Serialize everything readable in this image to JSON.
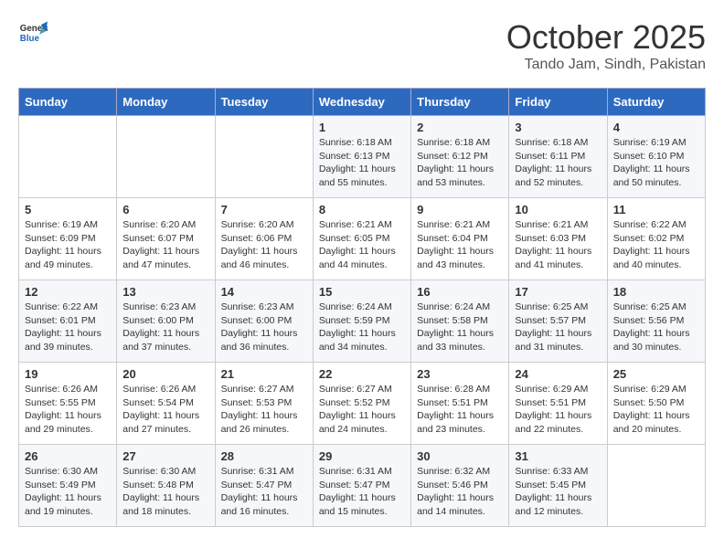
{
  "header": {
    "logo_line1": "General",
    "logo_line2": "Blue",
    "month": "October 2025",
    "location": "Tando Jam, Sindh, Pakistan"
  },
  "weekdays": [
    "Sunday",
    "Monday",
    "Tuesday",
    "Wednesday",
    "Thursday",
    "Friday",
    "Saturday"
  ],
  "weeks": [
    [
      {
        "day": "",
        "sunrise": "",
        "sunset": "",
        "daylight": ""
      },
      {
        "day": "",
        "sunrise": "",
        "sunset": "",
        "daylight": ""
      },
      {
        "day": "",
        "sunrise": "",
        "sunset": "",
        "daylight": ""
      },
      {
        "day": "1",
        "sunrise": "Sunrise: 6:18 AM",
        "sunset": "Sunset: 6:13 PM",
        "daylight": "Daylight: 11 hours and 55 minutes."
      },
      {
        "day": "2",
        "sunrise": "Sunrise: 6:18 AM",
        "sunset": "Sunset: 6:12 PM",
        "daylight": "Daylight: 11 hours and 53 minutes."
      },
      {
        "day": "3",
        "sunrise": "Sunrise: 6:18 AM",
        "sunset": "Sunset: 6:11 PM",
        "daylight": "Daylight: 11 hours and 52 minutes."
      },
      {
        "day": "4",
        "sunrise": "Sunrise: 6:19 AM",
        "sunset": "Sunset: 6:10 PM",
        "daylight": "Daylight: 11 hours and 50 minutes."
      }
    ],
    [
      {
        "day": "5",
        "sunrise": "Sunrise: 6:19 AM",
        "sunset": "Sunset: 6:09 PM",
        "daylight": "Daylight: 11 hours and 49 minutes."
      },
      {
        "day": "6",
        "sunrise": "Sunrise: 6:20 AM",
        "sunset": "Sunset: 6:07 PM",
        "daylight": "Daylight: 11 hours and 47 minutes."
      },
      {
        "day": "7",
        "sunrise": "Sunrise: 6:20 AM",
        "sunset": "Sunset: 6:06 PM",
        "daylight": "Daylight: 11 hours and 46 minutes."
      },
      {
        "day": "8",
        "sunrise": "Sunrise: 6:21 AM",
        "sunset": "Sunset: 6:05 PM",
        "daylight": "Daylight: 11 hours and 44 minutes."
      },
      {
        "day": "9",
        "sunrise": "Sunrise: 6:21 AM",
        "sunset": "Sunset: 6:04 PM",
        "daylight": "Daylight: 11 hours and 43 minutes."
      },
      {
        "day": "10",
        "sunrise": "Sunrise: 6:21 AM",
        "sunset": "Sunset: 6:03 PM",
        "daylight": "Daylight: 11 hours and 41 minutes."
      },
      {
        "day": "11",
        "sunrise": "Sunrise: 6:22 AM",
        "sunset": "Sunset: 6:02 PM",
        "daylight": "Daylight: 11 hours and 40 minutes."
      }
    ],
    [
      {
        "day": "12",
        "sunrise": "Sunrise: 6:22 AM",
        "sunset": "Sunset: 6:01 PM",
        "daylight": "Daylight: 11 hours and 39 minutes."
      },
      {
        "day": "13",
        "sunrise": "Sunrise: 6:23 AM",
        "sunset": "Sunset: 6:00 PM",
        "daylight": "Daylight: 11 hours and 37 minutes."
      },
      {
        "day": "14",
        "sunrise": "Sunrise: 6:23 AM",
        "sunset": "Sunset: 6:00 PM",
        "daylight": "Daylight: 11 hours and 36 minutes."
      },
      {
        "day": "15",
        "sunrise": "Sunrise: 6:24 AM",
        "sunset": "Sunset: 5:59 PM",
        "daylight": "Daylight: 11 hours and 34 minutes."
      },
      {
        "day": "16",
        "sunrise": "Sunrise: 6:24 AM",
        "sunset": "Sunset: 5:58 PM",
        "daylight": "Daylight: 11 hours and 33 minutes."
      },
      {
        "day": "17",
        "sunrise": "Sunrise: 6:25 AM",
        "sunset": "Sunset: 5:57 PM",
        "daylight": "Daylight: 11 hours and 31 minutes."
      },
      {
        "day": "18",
        "sunrise": "Sunrise: 6:25 AM",
        "sunset": "Sunset: 5:56 PM",
        "daylight": "Daylight: 11 hours and 30 minutes."
      }
    ],
    [
      {
        "day": "19",
        "sunrise": "Sunrise: 6:26 AM",
        "sunset": "Sunset: 5:55 PM",
        "daylight": "Daylight: 11 hours and 29 minutes."
      },
      {
        "day": "20",
        "sunrise": "Sunrise: 6:26 AM",
        "sunset": "Sunset: 5:54 PM",
        "daylight": "Daylight: 11 hours and 27 minutes."
      },
      {
        "day": "21",
        "sunrise": "Sunrise: 6:27 AM",
        "sunset": "Sunset: 5:53 PM",
        "daylight": "Daylight: 11 hours and 26 minutes."
      },
      {
        "day": "22",
        "sunrise": "Sunrise: 6:27 AM",
        "sunset": "Sunset: 5:52 PM",
        "daylight": "Daylight: 11 hours and 24 minutes."
      },
      {
        "day": "23",
        "sunrise": "Sunrise: 6:28 AM",
        "sunset": "Sunset: 5:51 PM",
        "daylight": "Daylight: 11 hours and 23 minutes."
      },
      {
        "day": "24",
        "sunrise": "Sunrise: 6:29 AM",
        "sunset": "Sunset: 5:51 PM",
        "daylight": "Daylight: 11 hours and 22 minutes."
      },
      {
        "day": "25",
        "sunrise": "Sunrise: 6:29 AM",
        "sunset": "Sunset: 5:50 PM",
        "daylight": "Daylight: 11 hours and 20 minutes."
      }
    ],
    [
      {
        "day": "26",
        "sunrise": "Sunrise: 6:30 AM",
        "sunset": "Sunset: 5:49 PM",
        "daylight": "Daylight: 11 hours and 19 minutes."
      },
      {
        "day": "27",
        "sunrise": "Sunrise: 6:30 AM",
        "sunset": "Sunset: 5:48 PM",
        "daylight": "Daylight: 11 hours and 18 minutes."
      },
      {
        "day": "28",
        "sunrise": "Sunrise: 6:31 AM",
        "sunset": "Sunset: 5:47 PM",
        "daylight": "Daylight: 11 hours and 16 minutes."
      },
      {
        "day": "29",
        "sunrise": "Sunrise: 6:31 AM",
        "sunset": "Sunset: 5:47 PM",
        "daylight": "Daylight: 11 hours and 15 minutes."
      },
      {
        "day": "30",
        "sunrise": "Sunrise: 6:32 AM",
        "sunset": "Sunset: 5:46 PM",
        "daylight": "Daylight: 11 hours and 14 minutes."
      },
      {
        "day": "31",
        "sunrise": "Sunrise: 6:33 AM",
        "sunset": "Sunset: 5:45 PM",
        "daylight": "Daylight: 11 hours and 12 minutes."
      },
      {
        "day": "",
        "sunrise": "",
        "sunset": "",
        "daylight": ""
      }
    ]
  ]
}
